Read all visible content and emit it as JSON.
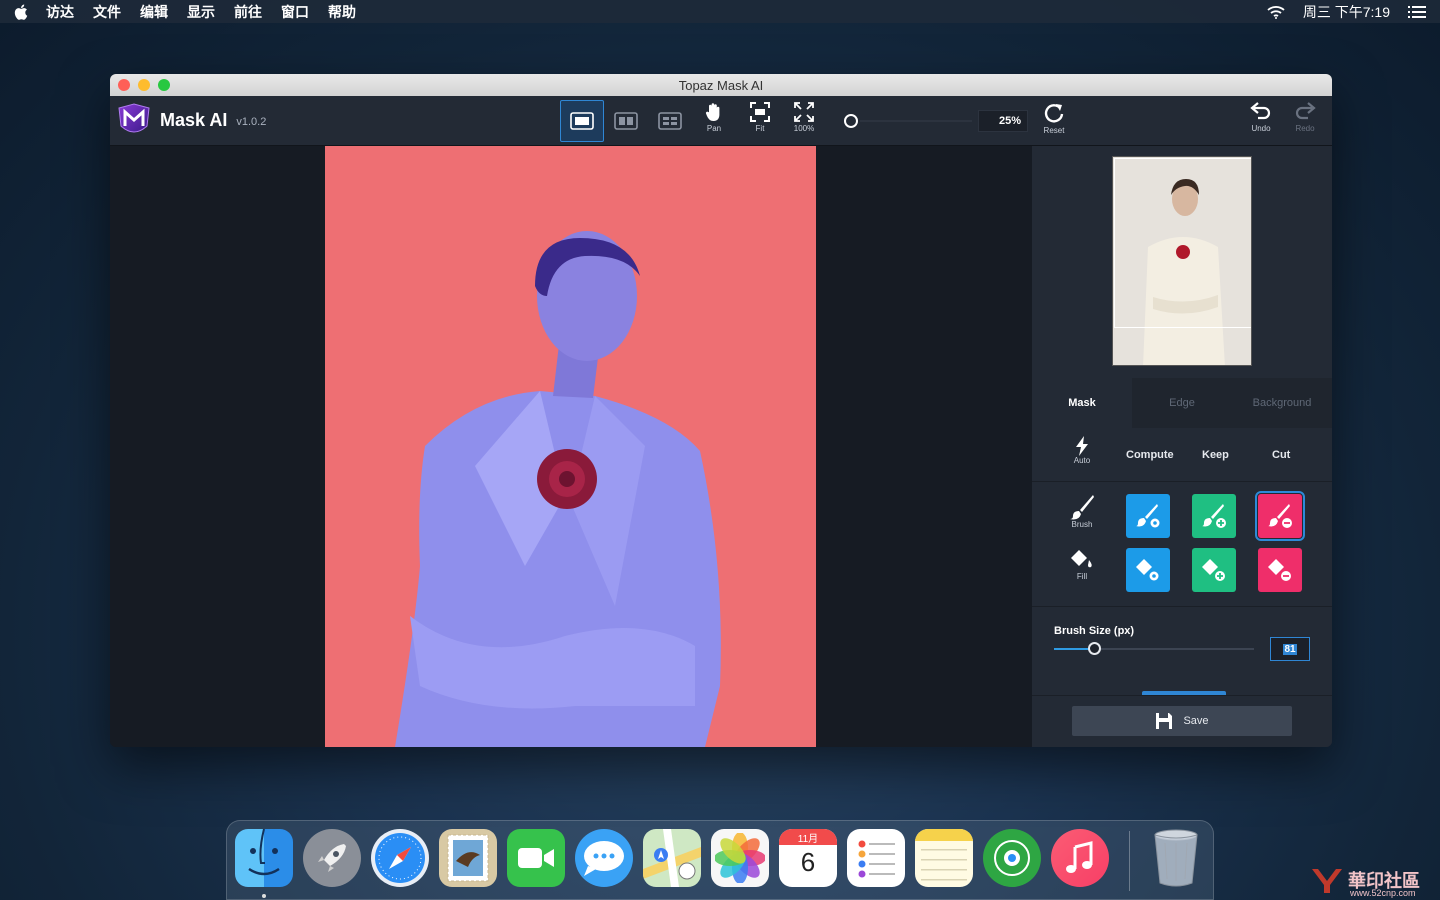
{
  "menubar": {
    "items": [
      "访达",
      "文件",
      "编辑",
      "显示",
      "前往",
      "窗口",
      "帮助"
    ],
    "clock": "周三 下午7:19"
  },
  "window": {
    "title": "Topaz Mask AI",
    "app_name": "Mask AI",
    "version": "v1.0.2"
  },
  "toolbar": {
    "pan_label": "Pan",
    "fit_label": "Fit",
    "full_label": "100%",
    "zoom_value": "25%",
    "reset_label": "Reset",
    "undo_label": "Undo",
    "redo_label": "Redo"
  },
  "sidebar": {
    "tabs": [
      "Mask",
      "Edge",
      "Background"
    ],
    "auto_label": "Auto",
    "compute_label": "Compute",
    "keep_label": "Keep",
    "cut_label": "Cut",
    "brush_label": "Brush",
    "fill_label": "Fill",
    "brush_size_label": "Brush Size (px)",
    "brush_size_value": "81",
    "brush_size_fraction": 0.2,
    "save_label": "Save"
  },
  "dock": {
    "calendar_month": "11月",
    "calendar_day": "6"
  },
  "corner": {
    "text": "華印社區",
    "sub": "www.52cnp.com"
  },
  "colors": {
    "accent": "#2f86d4",
    "keep": "#1fbf82",
    "cut": "#ef2e6a",
    "compute": "#1c9be8",
    "background_mask": "#ee6f73"
  }
}
